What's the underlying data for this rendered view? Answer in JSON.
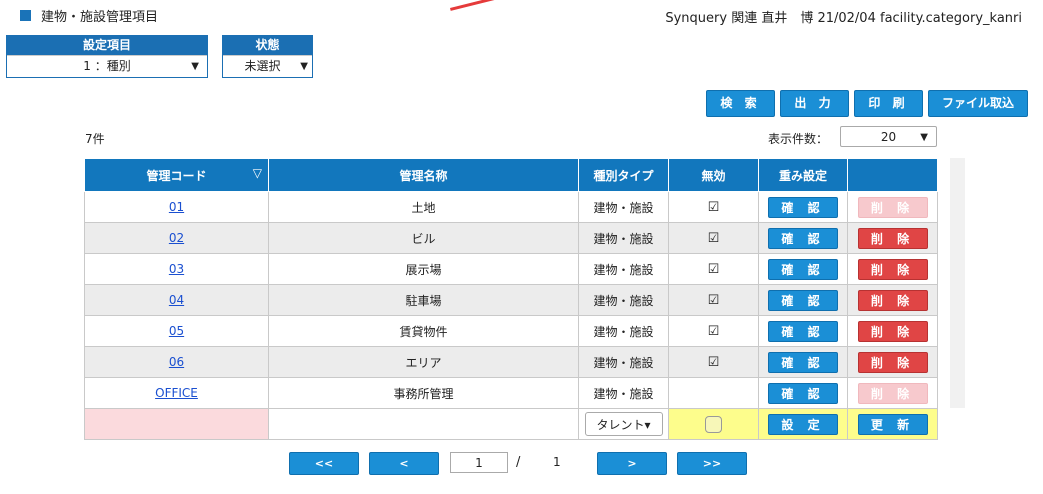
{
  "header": {
    "title": "建物・施設管理項目",
    "info": "Synquery 関連 直井　博 21/02/04 facility.category_kanri"
  },
  "filters": {
    "setting": {
      "label": "設定項目",
      "value": "1 ：種別"
    },
    "status": {
      "label": "状態",
      "value": "未選択"
    }
  },
  "actions": {
    "search": "検 索",
    "output": "出 力",
    "print": "印 刷",
    "import": "ファイル取込"
  },
  "list": {
    "count": "7件",
    "per_page_label": "表示件数：",
    "per_page_value": "20"
  },
  "table": {
    "headers": [
      "管理コード",
      "管理名称",
      "種別タイプ",
      "無効",
      "重み設定",
      ""
    ],
    "confirm_label": "確 認",
    "delete_label": "削 除",
    "rows": [
      {
        "code": "01",
        "name": "土地",
        "type": "建物・施設",
        "disabled": "☑",
        "delete_enabled": false
      },
      {
        "code": "02",
        "name": "ビル",
        "type": "建物・施設",
        "disabled": "☑",
        "delete_enabled": true
      },
      {
        "code": "03",
        "name": "展示場",
        "type": "建物・施設",
        "disabled": "☑",
        "delete_enabled": true
      },
      {
        "code": "04",
        "name": "駐車場",
        "type": "建物・施設",
        "disabled": "☑",
        "delete_enabled": true
      },
      {
        "code": "05",
        "name": "賃貸物件",
        "type": "建物・施設",
        "disabled": "☑",
        "delete_enabled": true
      },
      {
        "code": "06",
        "name": "エリア",
        "type": "建物・施設",
        "disabled": "☑",
        "delete_enabled": true
      },
      {
        "code": "OFFICE",
        "name": "事務所管理",
        "type": "建物・施設",
        "disabled": "",
        "delete_enabled": false
      }
    ],
    "new_row": {
      "type_value": "タレント",
      "set_label": "設 定",
      "update_label": "更 新"
    }
  },
  "pager": {
    "first": "<<",
    "prev": "<",
    "current": "1",
    "slash": "/",
    "total": "1",
    "next": ">",
    "last": ">>"
  },
  "colors": {
    "header_blue": "#1277bd",
    "button_blue": "#1b8fd6",
    "delete_red": "#e04545",
    "delete_disabled": "#f7c9cd",
    "new_row_yellow": "#fdfd8c",
    "new_row_pink": "#fbdadd"
  }
}
